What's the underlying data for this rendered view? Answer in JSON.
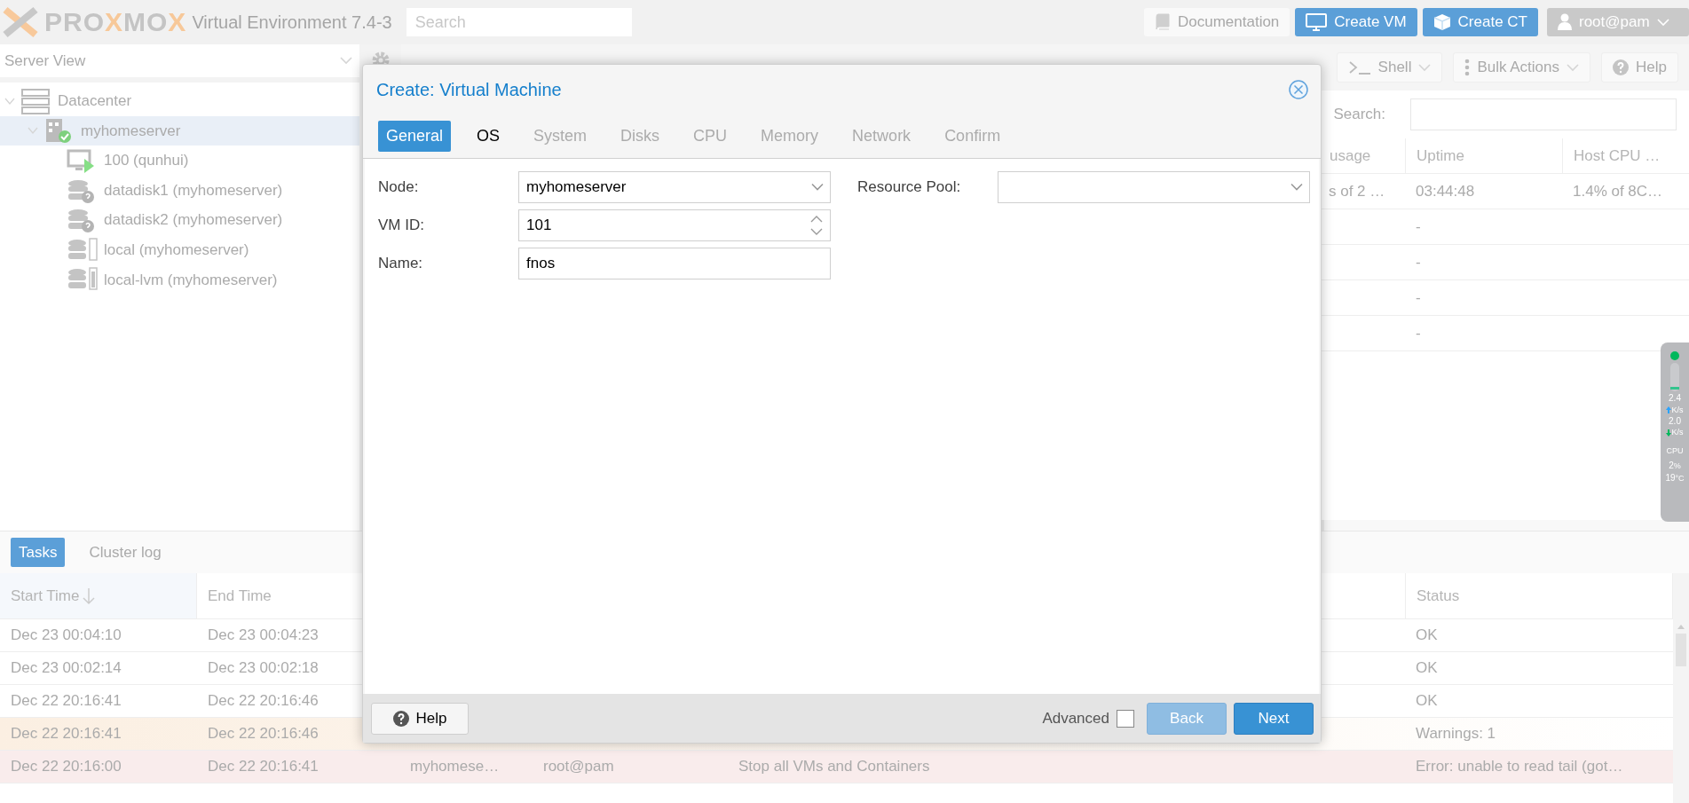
{
  "header": {
    "logo": [
      {
        "text": "PRO",
        "accent": false
      },
      {
        "text": "X",
        "accent": true
      },
      {
        "text": "MO",
        "accent": false
      },
      {
        "text": "X",
        "accent": true
      }
    ],
    "version": "Virtual Environment 7.4-3",
    "search": {
      "placeholder": "Search"
    },
    "buttons": [
      {
        "label": "Documentation",
        "kind": "doc"
      },
      {
        "label": "Create VM",
        "kind": "vm"
      },
      {
        "label": "Create CT",
        "kind": "ct"
      }
    ],
    "user": "root@pam"
  },
  "sidebar": {
    "view": "Server View",
    "tree": [
      {
        "label": "Datacenter",
        "kind": "datacenter",
        "expanded": true,
        "selected": false,
        "children": [
          {
            "label": "myhomeserver",
            "kind": "node",
            "expanded": true,
            "selected": true,
            "children": [
              {
                "label": "100 (qunhui)",
                "kind": "vm",
                "selected": false
              },
              {
                "label": "datadisk1 (myhomeserver)",
                "kind": "storage-unknown",
                "selected": false
              },
              {
                "label": "datadisk2 (myhomeserver)",
                "kind": "storage-unknown",
                "selected": false
              },
              {
                "label": "local (myhomeserver)",
                "kind": "storage-dir",
                "selected": false
              },
              {
                "label": "local-lvm (myhomeserver)",
                "kind": "storage-lvm",
                "selected": false
              }
            ]
          }
        ]
      }
    ]
  },
  "content": {
    "toolbar": [
      {
        "label": "Shell",
        "kind": "shell"
      },
      {
        "label": "Bulk Actions",
        "kind": "menu"
      },
      {
        "label": "Help",
        "kind": "help"
      }
    ],
    "search_label": "Search:",
    "columns": [
      "usage",
      "Uptime",
      "Host CPU …"
    ],
    "rows": [
      {
        "cells": [
          "s of 2 …",
          "03:44:48",
          "1.4% of 8C…"
        ]
      },
      {
        "cells": [
          null,
          "-",
          null
        ]
      },
      {
        "cells": [
          null,
          "-",
          null
        ]
      },
      {
        "cells": [
          null,
          "-",
          null
        ]
      },
      {
        "cells": [
          null,
          "-",
          null
        ]
      }
    ]
  },
  "tray_monitor": {
    "upload": {
      "value": "2.4",
      "unit": "K/s"
    },
    "download": {
      "value": "2.0",
      "unit": "K/s"
    },
    "cpu_label": "CPU",
    "cpu": {
      "value": "2",
      "unit": "%"
    },
    "temperature": {
      "value": "19",
      "unit": "°C"
    }
  },
  "tasks": {
    "tabs": [
      {
        "label": "Tasks",
        "selected": true
      },
      {
        "label": "Cluster log",
        "selected": false
      }
    ],
    "columns": [
      {
        "label": "Start Time",
        "sorted": true
      },
      {
        "label": "End Time",
        "sorted": false
      },
      {},
      {},
      {},
      {
        "label": "Status",
        "sorted": false
      }
    ],
    "rows": [
      {
        "warning": false,
        "error": false,
        "cells": [
          "Dec 23 00:04:10",
          "Dec 23 00:04:23",
          null,
          null,
          null,
          "OK"
        ]
      },
      {
        "warning": false,
        "error": false,
        "cells": [
          "Dec 23 00:02:14",
          "Dec 23 00:02:18",
          null,
          null,
          null,
          "OK"
        ]
      },
      {
        "warning": false,
        "error": false,
        "cells": [
          "Dec 22 20:16:41",
          "Dec 22 20:16:46",
          null,
          null,
          null,
          "OK"
        ]
      },
      {
        "warning": true,
        "error": false,
        "cells": [
          "Dec 22 20:16:41",
          "Dec 22 20:16:46",
          null,
          null,
          null,
          "Warnings: 1"
        ]
      },
      {
        "warning": false,
        "error": true,
        "cells": [
          "Dec 22 20:16:00",
          "Dec 22 20:16:41",
          "myhomese…",
          "root@pam",
          "Stop all VMs and Containers",
          "Error: unable to read tail (got…"
        ]
      }
    ]
  },
  "dialog": {
    "title": "Create: Virtual Machine",
    "tabs": [
      {
        "label": "General",
        "selected": true,
        "disabled": false
      },
      {
        "label": "OS",
        "selected": false,
        "disabled": false
      },
      {
        "label": "System",
        "selected": false,
        "disabled": true
      },
      {
        "label": "Disks",
        "selected": false,
        "disabled": true
      },
      {
        "label": "CPU",
        "selected": false,
        "disabled": true
      },
      {
        "label": "Memory",
        "selected": false,
        "disabled": true
      },
      {
        "label": "Network",
        "selected": false,
        "disabled": true
      },
      {
        "label": "Confirm",
        "selected": false,
        "disabled": true
      }
    ],
    "left_fields": [
      {
        "label": "Node:",
        "value": "myhomeserver",
        "kind": "combo"
      },
      {
        "label": "VM ID:",
        "value": "101",
        "kind": "spinner"
      },
      {
        "label": "Name:",
        "value": "fnos",
        "kind": "text"
      }
    ],
    "right_fields": [
      {
        "label": "Resource Pool:",
        "kind": "combo"
      }
    ],
    "help": "Help",
    "advanced": {
      "label": "Advanced",
      "checked": false
    },
    "back": {
      "label": "Back",
      "disabled": true
    },
    "next": {
      "label": "Next",
      "disabled": false
    }
  }
}
